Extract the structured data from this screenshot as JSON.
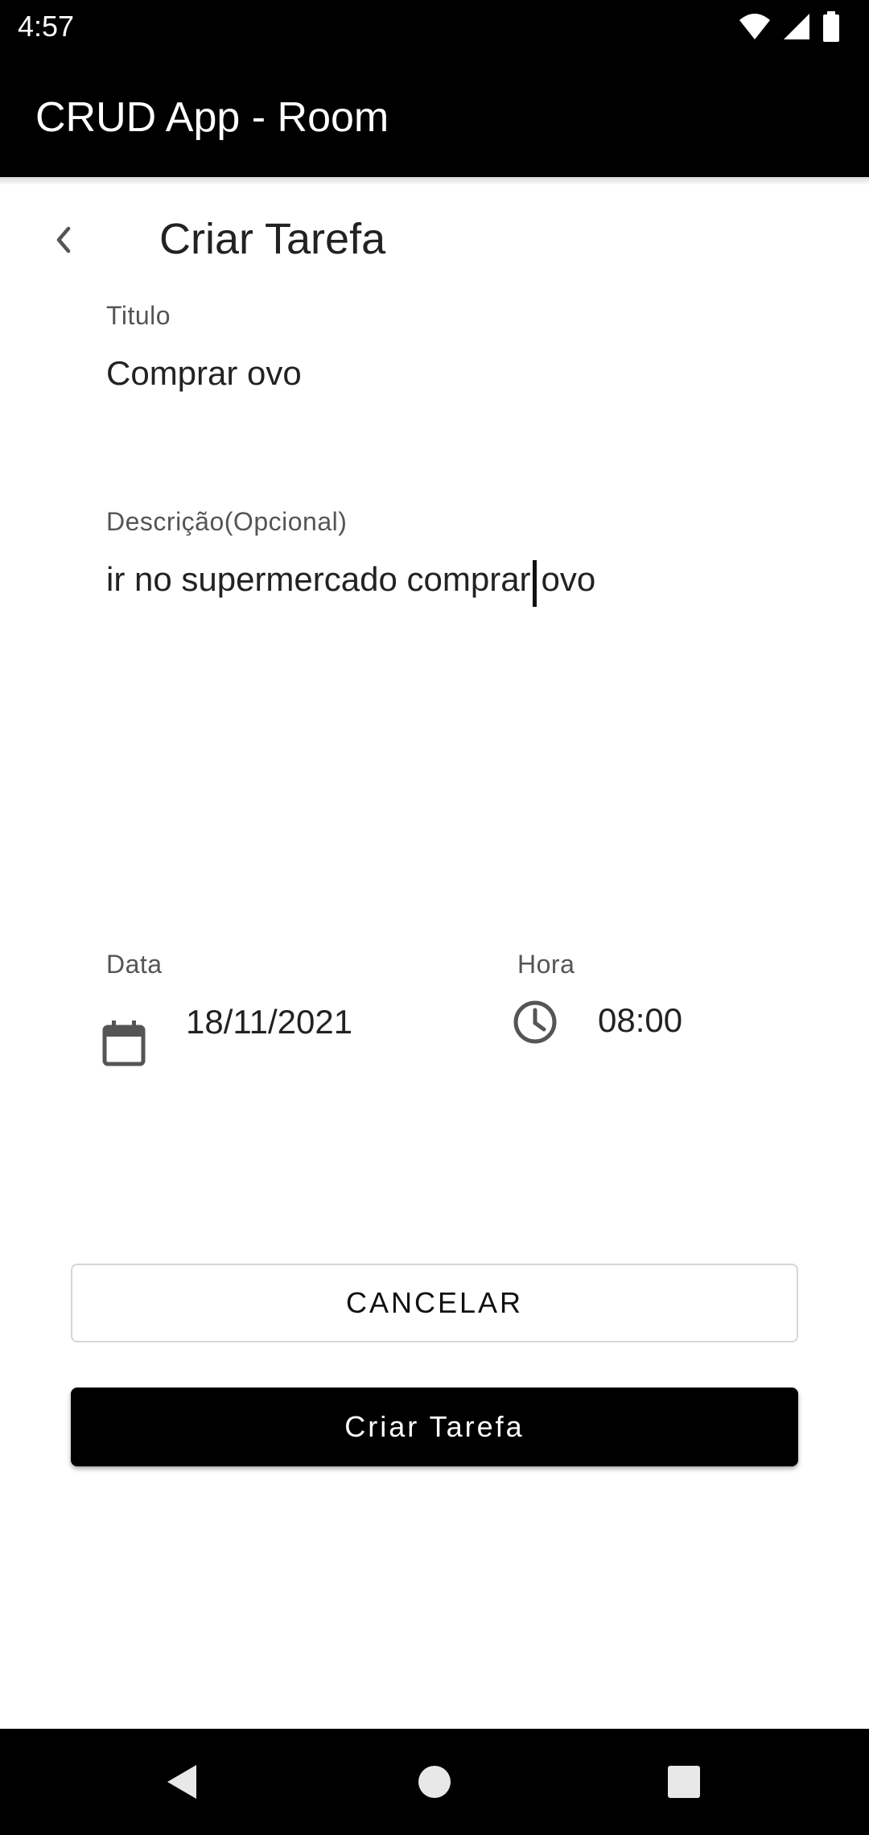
{
  "status_bar": {
    "time": "4:57"
  },
  "app_bar": {
    "title": "CRUD App - Room"
  },
  "page": {
    "title": "Criar Tarefa"
  },
  "form": {
    "title_label": "Titulo",
    "title_value": "Comprar ovo",
    "description_label": "Descrição(Opcional)",
    "description_before_cursor": "ir no supermercado comprar",
    "description_after_cursor": "ovo",
    "date_label": "Data",
    "date_value": "18/11/2021",
    "time_label": "Hora",
    "time_value": "08:00"
  },
  "buttons": {
    "cancel": "CANCELAR",
    "create": "Criar Tarefa"
  },
  "colors": {
    "app_bar": "#000000",
    "primary_button": "#000000",
    "background": "#ffffff"
  },
  "icons": [
    "wifi-icon",
    "signal-icon",
    "battery-icon",
    "back-arrow-icon",
    "calendar-icon",
    "clock-icon",
    "nav-back-icon",
    "nav-home-icon",
    "nav-recents-icon"
  ]
}
